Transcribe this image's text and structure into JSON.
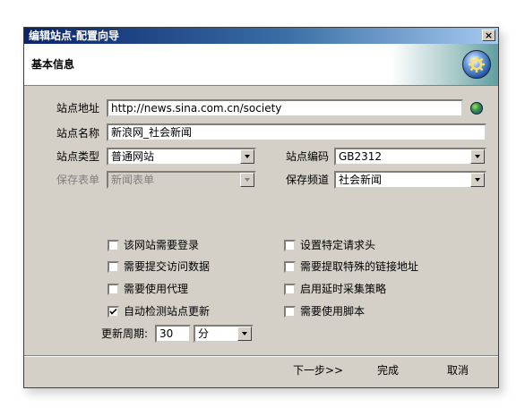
{
  "window": {
    "title": "编辑站点-配置向导",
    "close_glyph": "×"
  },
  "header": {
    "title": "基本信息",
    "icon": "wizard-gear-icon"
  },
  "form": {
    "site_url_label": "站点地址",
    "site_url_value": "http://news.sina.com.cn/society",
    "site_name_label": "站点名称",
    "site_name_value": "新浪网_社会新闻",
    "site_type_label": "站点类型",
    "site_type_value": "普通网站",
    "site_encoding_label": "站点编码",
    "site_encoding_value": "GB2312",
    "save_table_label": "保存表单",
    "save_table_value": "新闻表单",
    "save_channel_label": "保存频道",
    "save_channel_value": "社会新闻"
  },
  "options": {
    "left": [
      {
        "label": "该网站需要登录",
        "checked": false
      },
      {
        "label": "需要提交访问数据",
        "checked": false
      },
      {
        "label": "需要使用代理",
        "checked": false
      },
      {
        "label": "自动检测站点更新",
        "checked": true
      }
    ],
    "right": [
      {
        "label": "设置特定请求头",
        "checked": false
      },
      {
        "label": "需要提取特殊的链接地址",
        "checked": false
      },
      {
        "label": "启用延时采集策略",
        "checked": false
      },
      {
        "label": "需要使用脚本",
        "checked": false
      }
    ]
  },
  "update": {
    "label": "更新周期:",
    "value": "30",
    "unit": "分"
  },
  "buttons": {
    "next": "下一步>>",
    "finish": "完成",
    "cancel": "取消"
  }
}
